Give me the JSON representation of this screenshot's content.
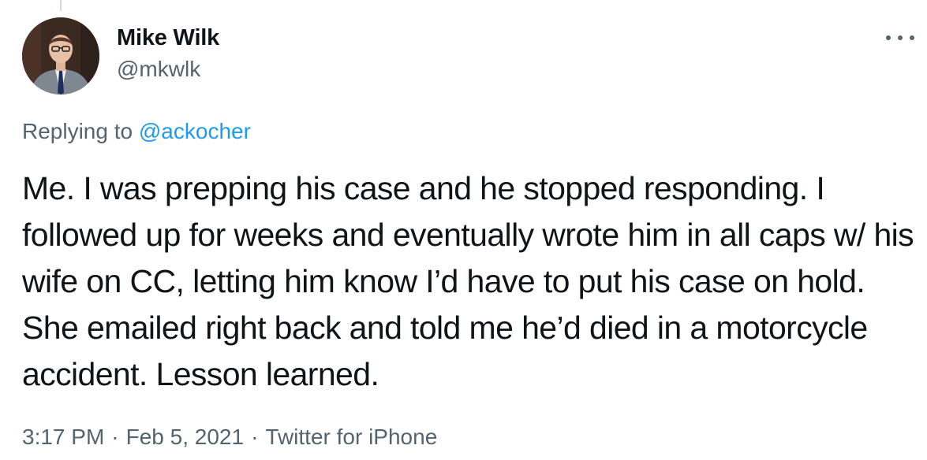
{
  "tweet": {
    "author": {
      "name": "Mike Wilk",
      "handle": "@mkwlk"
    },
    "replying_prefix": "Replying to",
    "replying_to": "@ackocher",
    "text": "Me. I was prepping his case and he stopped responding. I followed up for weeks and eventually wrote him in all caps w/ his wife on CC, letting him know I’d have to put his case on hold. She emailed right back and told me he’d died in a motorcycle accident. Lesson learned.",
    "time": "3:17 PM",
    "date": "Feb 5, 2021",
    "source": "Twitter for iPhone",
    "separator": "·",
    "more_icon": "more-horizontal-icon"
  },
  "colors": {
    "text": "#0f1419",
    "secondary": "#536471",
    "link": "#1d9bf0",
    "thread_line": "#cfd9de"
  }
}
